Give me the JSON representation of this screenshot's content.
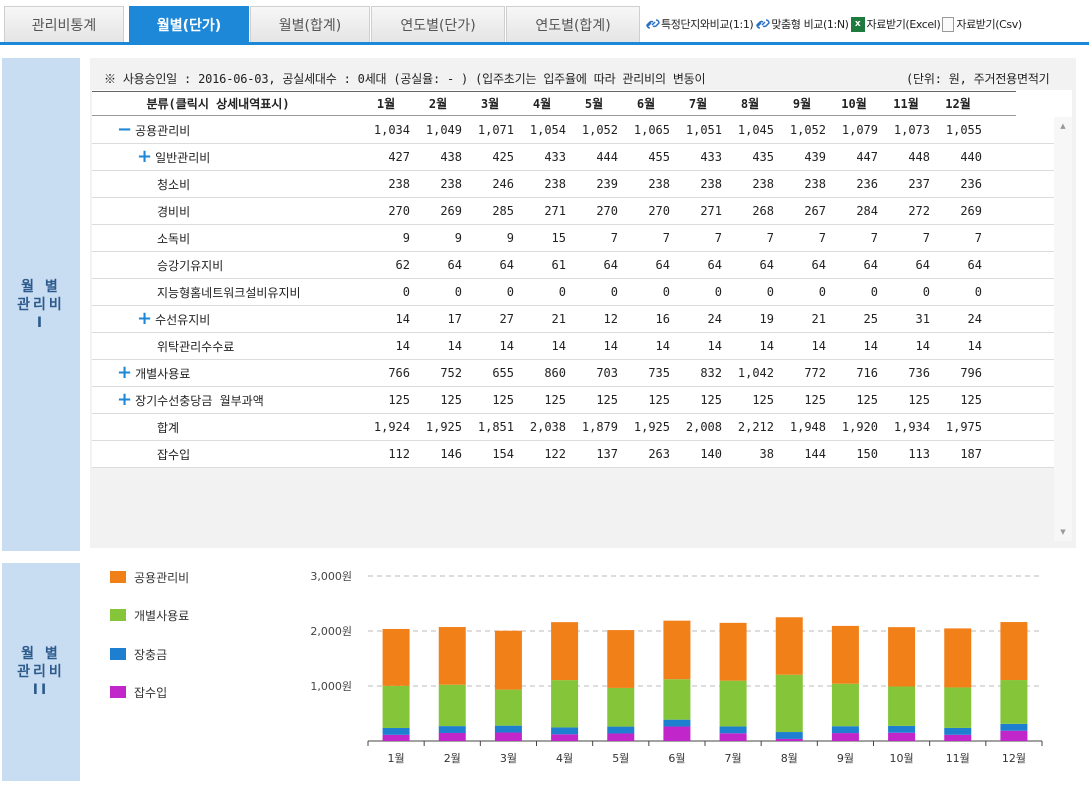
{
  "tabs": [
    {
      "label": "관리비통계",
      "active": false
    },
    {
      "label": "월별(단가)",
      "active": true
    },
    {
      "label": "월별(합계)",
      "active": false
    },
    {
      "label": "연도별(단가)",
      "active": false
    },
    {
      "label": "연도별(합계)",
      "active": false
    }
  ],
  "tools": {
    "compare_one": "특정단지와비교(1:1)",
    "compare_many": "맞춤형 비교(1:N)",
    "excel": "자료받기(Excel)",
    "csv": "자료받기(Csv)"
  },
  "side_labels": {
    "first": "월  별\n관리비\nI",
    "second": "월  별\n관리비\nII"
  },
  "notice": {
    "text": "※ 사용승인일 : 2016-06-03, 공실세대수 : 0세대 (공실율: - ) (입주초기는 입주율에 따라 관리비의 변동이",
    "unit": "(단위: 원, 주거전용면적기"
  },
  "table": {
    "header_label": "분류(클릭시 상세내역표시)",
    "months": [
      "1월",
      "2월",
      "3월",
      "4월",
      "5월",
      "6월",
      "7월",
      "8월",
      "9월",
      "10월",
      "11월",
      "12월"
    ],
    "rows": [
      {
        "label": "공용관리비",
        "sign": "−",
        "level": 0,
        "values": [
          "1,034",
          "1,049",
          "1,071",
          "1,054",
          "1,052",
          "1,065",
          "1,051",
          "1,045",
          "1,052",
          "1,079",
          "1,073",
          "1,055"
        ]
      },
      {
        "label": "일반관리비",
        "sign": "+",
        "level": 1,
        "values": [
          "427",
          "438",
          "425",
          "433",
          "444",
          "455",
          "433",
          "435",
          "439",
          "447",
          "448",
          "440"
        ]
      },
      {
        "label": "청소비",
        "sign": "",
        "level": 2,
        "values": [
          "238",
          "238",
          "246",
          "238",
          "239",
          "238",
          "238",
          "238",
          "238",
          "236",
          "237",
          "236"
        ]
      },
      {
        "label": "경비비",
        "sign": "",
        "level": 2,
        "values": [
          "270",
          "269",
          "285",
          "271",
          "270",
          "270",
          "271",
          "268",
          "267",
          "284",
          "272",
          "269"
        ]
      },
      {
        "label": "소독비",
        "sign": "",
        "level": 2,
        "values": [
          "9",
          "9",
          "9",
          "15",
          "7",
          "7",
          "7",
          "7",
          "7",
          "7",
          "7",
          "7"
        ]
      },
      {
        "label": "승강기유지비",
        "sign": "",
        "level": 2,
        "values": [
          "62",
          "64",
          "64",
          "61",
          "64",
          "64",
          "64",
          "64",
          "64",
          "64",
          "64",
          "64"
        ]
      },
      {
        "label": "지능형홈네트워크설비유지비",
        "sign": "",
        "level": 2,
        "values": [
          "0",
          "0",
          "0",
          "0",
          "0",
          "0",
          "0",
          "0",
          "0",
          "0",
          "0",
          "0"
        ]
      },
      {
        "label": "수선유지비",
        "sign": "+",
        "level": 1,
        "values": [
          "14",
          "17",
          "27",
          "21",
          "12",
          "16",
          "24",
          "19",
          "21",
          "25",
          "31",
          "24"
        ]
      },
      {
        "label": "위탁관리수수료",
        "sign": "",
        "level": 2,
        "values": [
          "14",
          "14",
          "14",
          "14",
          "14",
          "14",
          "14",
          "14",
          "14",
          "14",
          "14",
          "14"
        ]
      },
      {
        "label": "개별사용료",
        "sign": "+",
        "level": 0,
        "values": [
          "766",
          "752",
          "655",
          "860",
          "703",
          "735",
          "832",
          "1,042",
          "772",
          "716",
          "736",
          "796"
        ]
      },
      {
        "label": "장기수선충당금 월부과액",
        "sign": "+",
        "level": 0,
        "values": [
          "125",
          "125",
          "125",
          "125",
          "125",
          "125",
          "125",
          "125",
          "125",
          "125",
          "125",
          "125"
        ]
      },
      {
        "label": "합계",
        "sign": "",
        "level": 2,
        "values": [
          "1,924",
          "1,925",
          "1,851",
          "2,038",
          "1,879",
          "1,925",
          "2,008",
          "2,212",
          "1,948",
          "1,920",
          "1,934",
          "1,975"
        ]
      },
      {
        "label": "잡수입",
        "sign": "",
        "level": 2,
        "values": [
          "112",
          "146",
          "154",
          "122",
          "137",
          "263",
          "140",
          "38",
          "144",
          "150",
          "113",
          "187"
        ]
      }
    ]
  },
  "chart_data": {
    "type": "bar",
    "stacked": true,
    "categories": [
      "1월",
      "2월",
      "3월",
      "4월",
      "5월",
      "6월",
      "7월",
      "8월",
      "9월",
      "10월",
      "11월",
      "12월"
    ],
    "series": [
      {
        "name": "잡수입",
        "color": "#c026c9",
        "values": [
          112,
          146,
          154,
          122,
          137,
          263,
          140,
          38,
          144,
          150,
          113,
          187
        ]
      },
      {
        "name": "장충금",
        "color": "#1e7fd0",
        "values": [
          125,
          125,
          125,
          125,
          125,
          125,
          125,
          125,
          125,
          125,
          125,
          125
        ]
      },
      {
        "name": "개별사용료",
        "color": "#84c53a",
        "values": [
          766,
          752,
          655,
          860,
          703,
          735,
          832,
          1042,
          772,
          716,
          736,
          796
        ]
      },
      {
        "name": "공용관리비",
        "color": "#f28019",
        "values": [
          1034,
          1049,
          1071,
          1054,
          1052,
          1065,
          1051,
          1045,
          1052,
          1079,
          1073,
          1055
        ]
      }
    ],
    "legend_order": [
      "공용관리비",
      "개별사용료",
      "장충금",
      "잡수입"
    ],
    "y_ticks": [
      1000,
      2000,
      3000
    ],
    "y_tick_labels": [
      "1,000원",
      "2,000원",
      "3,000원"
    ],
    "ylim": [
      0,
      3000
    ],
    "grid": true,
    "legend_position": "left"
  }
}
